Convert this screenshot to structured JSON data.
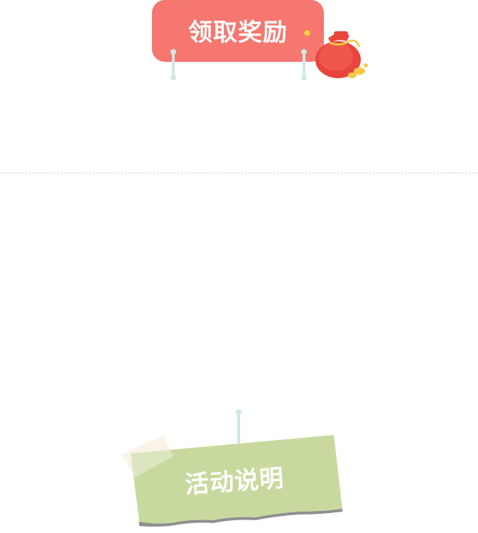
{
  "reward_button": {
    "label": "领取奖励"
  },
  "rules_note": {
    "label": "活动说明"
  },
  "colors": {
    "banner": "#f67670",
    "note": "#c8d99f",
    "string": "#cfe8e3",
    "divider": "#cfcfcf"
  },
  "icons": [
    "lucky-bag-icon",
    "coin-icon"
  ]
}
